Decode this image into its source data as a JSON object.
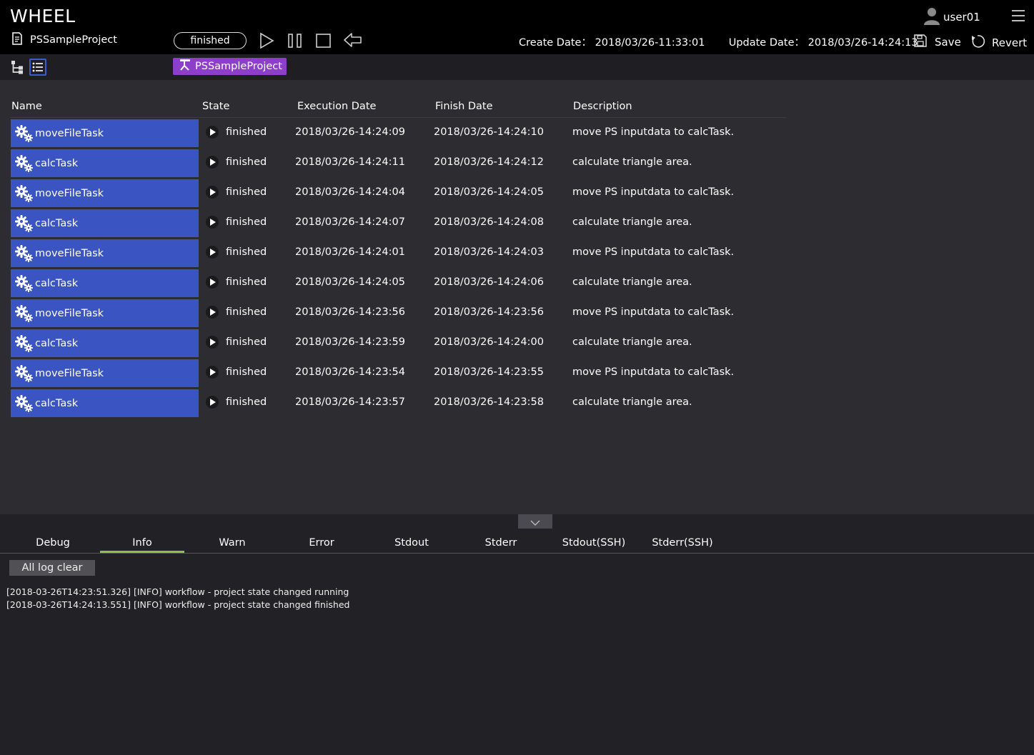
{
  "app": {
    "title": "WHEEL"
  },
  "user": {
    "name": "user01"
  },
  "project": {
    "name": "PSSampleProject",
    "state": "finished",
    "create_label": "Create Date：",
    "create_date": "2018/03/26-11:33:01",
    "update_label": "Update Date：",
    "update_date": "2018/03/26-14:24:13",
    "save_label": "Save",
    "revert_label": "Revert"
  },
  "breadcrumb": {
    "label": "PSSampleProject"
  },
  "table": {
    "headers": {
      "name": "Name",
      "state": "State",
      "execution": "Execution Date",
      "finish": "Finish Date",
      "description": "Description"
    },
    "rows": [
      {
        "name": "moveFileTask",
        "state": "finished",
        "exec": "2018/03/26-14:24:09",
        "finish": "2018/03/26-14:24:10",
        "desc": "move PS inputdata to calcTask."
      },
      {
        "name": "calcTask",
        "state": "finished",
        "exec": "2018/03/26-14:24:11",
        "finish": "2018/03/26-14:24:12",
        "desc": "calculate triangle area."
      },
      {
        "name": "moveFileTask",
        "state": "finished",
        "exec": "2018/03/26-14:24:04",
        "finish": "2018/03/26-14:24:05",
        "desc": "move PS inputdata to calcTask."
      },
      {
        "name": "calcTask",
        "state": "finished",
        "exec": "2018/03/26-14:24:07",
        "finish": "2018/03/26-14:24:08",
        "desc": "calculate triangle area."
      },
      {
        "name": "moveFileTask",
        "state": "finished",
        "exec": "2018/03/26-14:24:01",
        "finish": "2018/03/26-14:24:03",
        "desc": "move PS inputdata to calcTask."
      },
      {
        "name": "calcTask",
        "state": "finished",
        "exec": "2018/03/26-14:24:05",
        "finish": "2018/03/26-14:24:06",
        "desc": "calculate triangle area."
      },
      {
        "name": "moveFileTask",
        "state": "finished",
        "exec": "2018/03/26-14:23:56",
        "finish": "2018/03/26-14:23:56",
        "desc": "move PS inputdata to calcTask."
      },
      {
        "name": "calcTask",
        "state": "finished",
        "exec": "2018/03/26-14:23:59",
        "finish": "2018/03/26-14:24:00",
        "desc": "calculate triangle area."
      },
      {
        "name": "moveFileTask",
        "state": "finished",
        "exec": "2018/03/26-14:23:54",
        "finish": "2018/03/26-14:23:55",
        "desc": "move PS inputdata to calcTask."
      },
      {
        "name": "calcTask",
        "state": "finished",
        "exec": "2018/03/26-14:23:57",
        "finish": "2018/03/26-14:23:58",
        "desc": "calculate triangle area."
      }
    ]
  },
  "log_tabs": [
    "Debug",
    "Info",
    "Warn",
    "Error",
    "Stdout",
    "Stderr",
    "Stdout(SSH)",
    "Stderr(SSH)"
  ],
  "active_log_tab": "Info",
  "log": {
    "clear_label": "All log clear",
    "lines": [
      "[2018-03-26T14:23:51.326] [INFO] workflow - project state changed running",
      "[2018-03-26T14:24:13.551] [INFO] workflow - project state changed finished"
    ]
  },
  "colors": {
    "accent_task": "#3a54c1",
    "breadcrumb": "#8e3fc9",
    "active_tab": "#8bc34a"
  },
  "icons": [
    "document-icon",
    "play-icon",
    "pause-icon",
    "stop-icon",
    "return-icon",
    "save-icon",
    "revert-icon",
    "user-icon",
    "menu-icon",
    "graph-view-icon",
    "list-view-icon",
    "gear-icon",
    "chevron-down-icon"
  ]
}
